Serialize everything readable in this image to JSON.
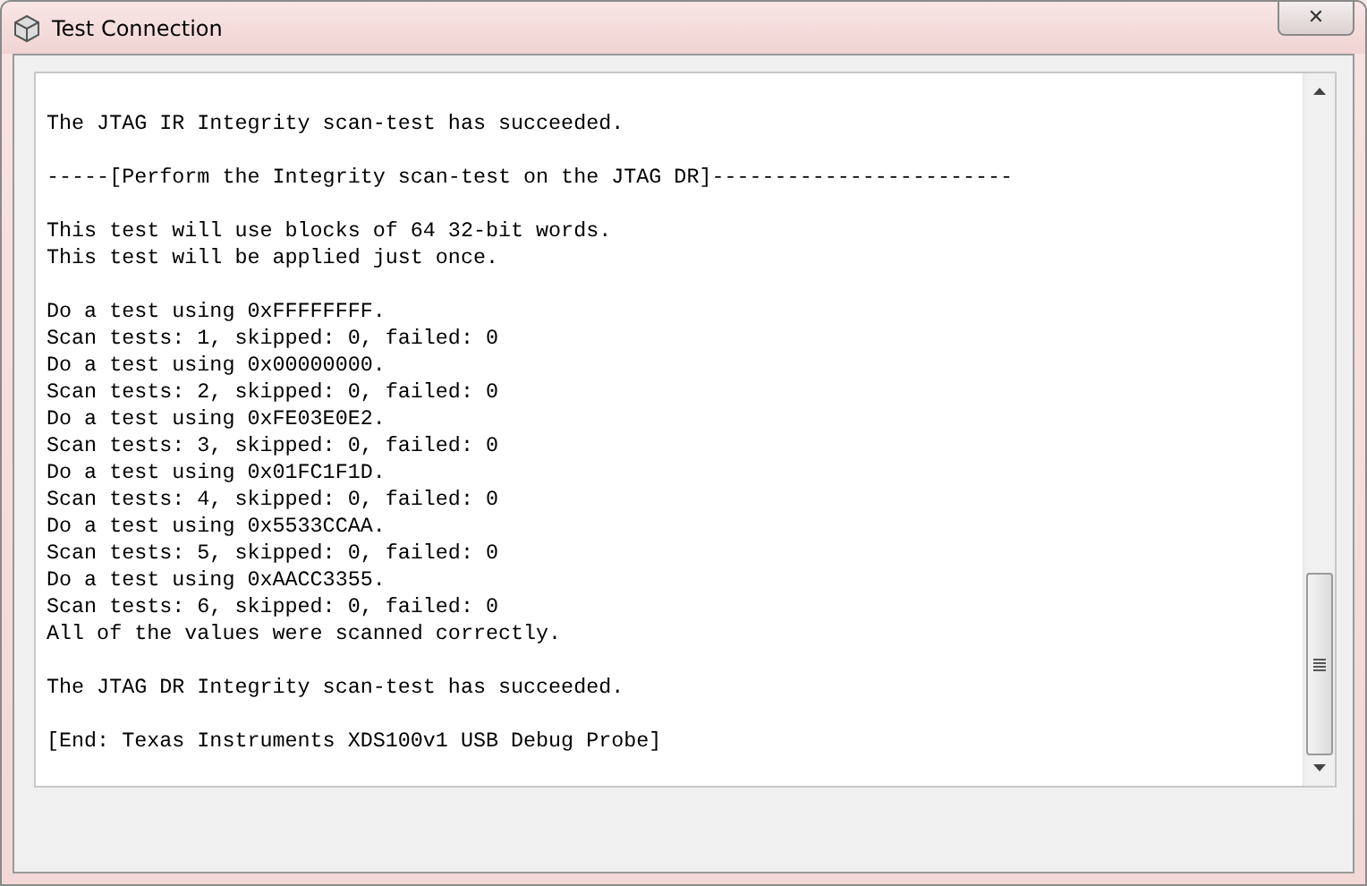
{
  "window": {
    "title": "Test Connection",
    "close": "✕"
  },
  "log": {
    "blocks": [
      [
        "The JTAG IR Integrity scan-test has succeeded."
      ],
      [
        "-----[Perform the Integrity scan-test on the JTAG DR]------------------------"
      ],
      [
        "This test will use blocks of 64 32-bit words.",
        "This test will be applied just once."
      ],
      [
        "Do a test using 0xFFFFFFFF.",
        "Scan tests: 1, skipped: 0, failed: 0",
        "Do a test using 0x00000000.",
        "Scan tests: 2, skipped: 0, failed: 0",
        "Do a test using 0xFE03E0E2.",
        "Scan tests: 3, skipped: 0, failed: 0",
        "Do a test using 0x01FC1F1D.",
        "Scan tests: 4, skipped: 0, failed: 0",
        "Do a test using 0x5533CCAA.",
        "Scan tests: 5, skipped: 0, failed: 0",
        "Do a test using 0xAACC3355.",
        "Scan tests: 6, skipped: 0, failed: 0",
        "All of the values were scanned correctly."
      ],
      [
        "The JTAG DR Integrity scan-test has succeeded."
      ],
      [
        "[End: Texas Instruments XDS100v1 USB Debug Probe]"
      ]
    ]
  }
}
